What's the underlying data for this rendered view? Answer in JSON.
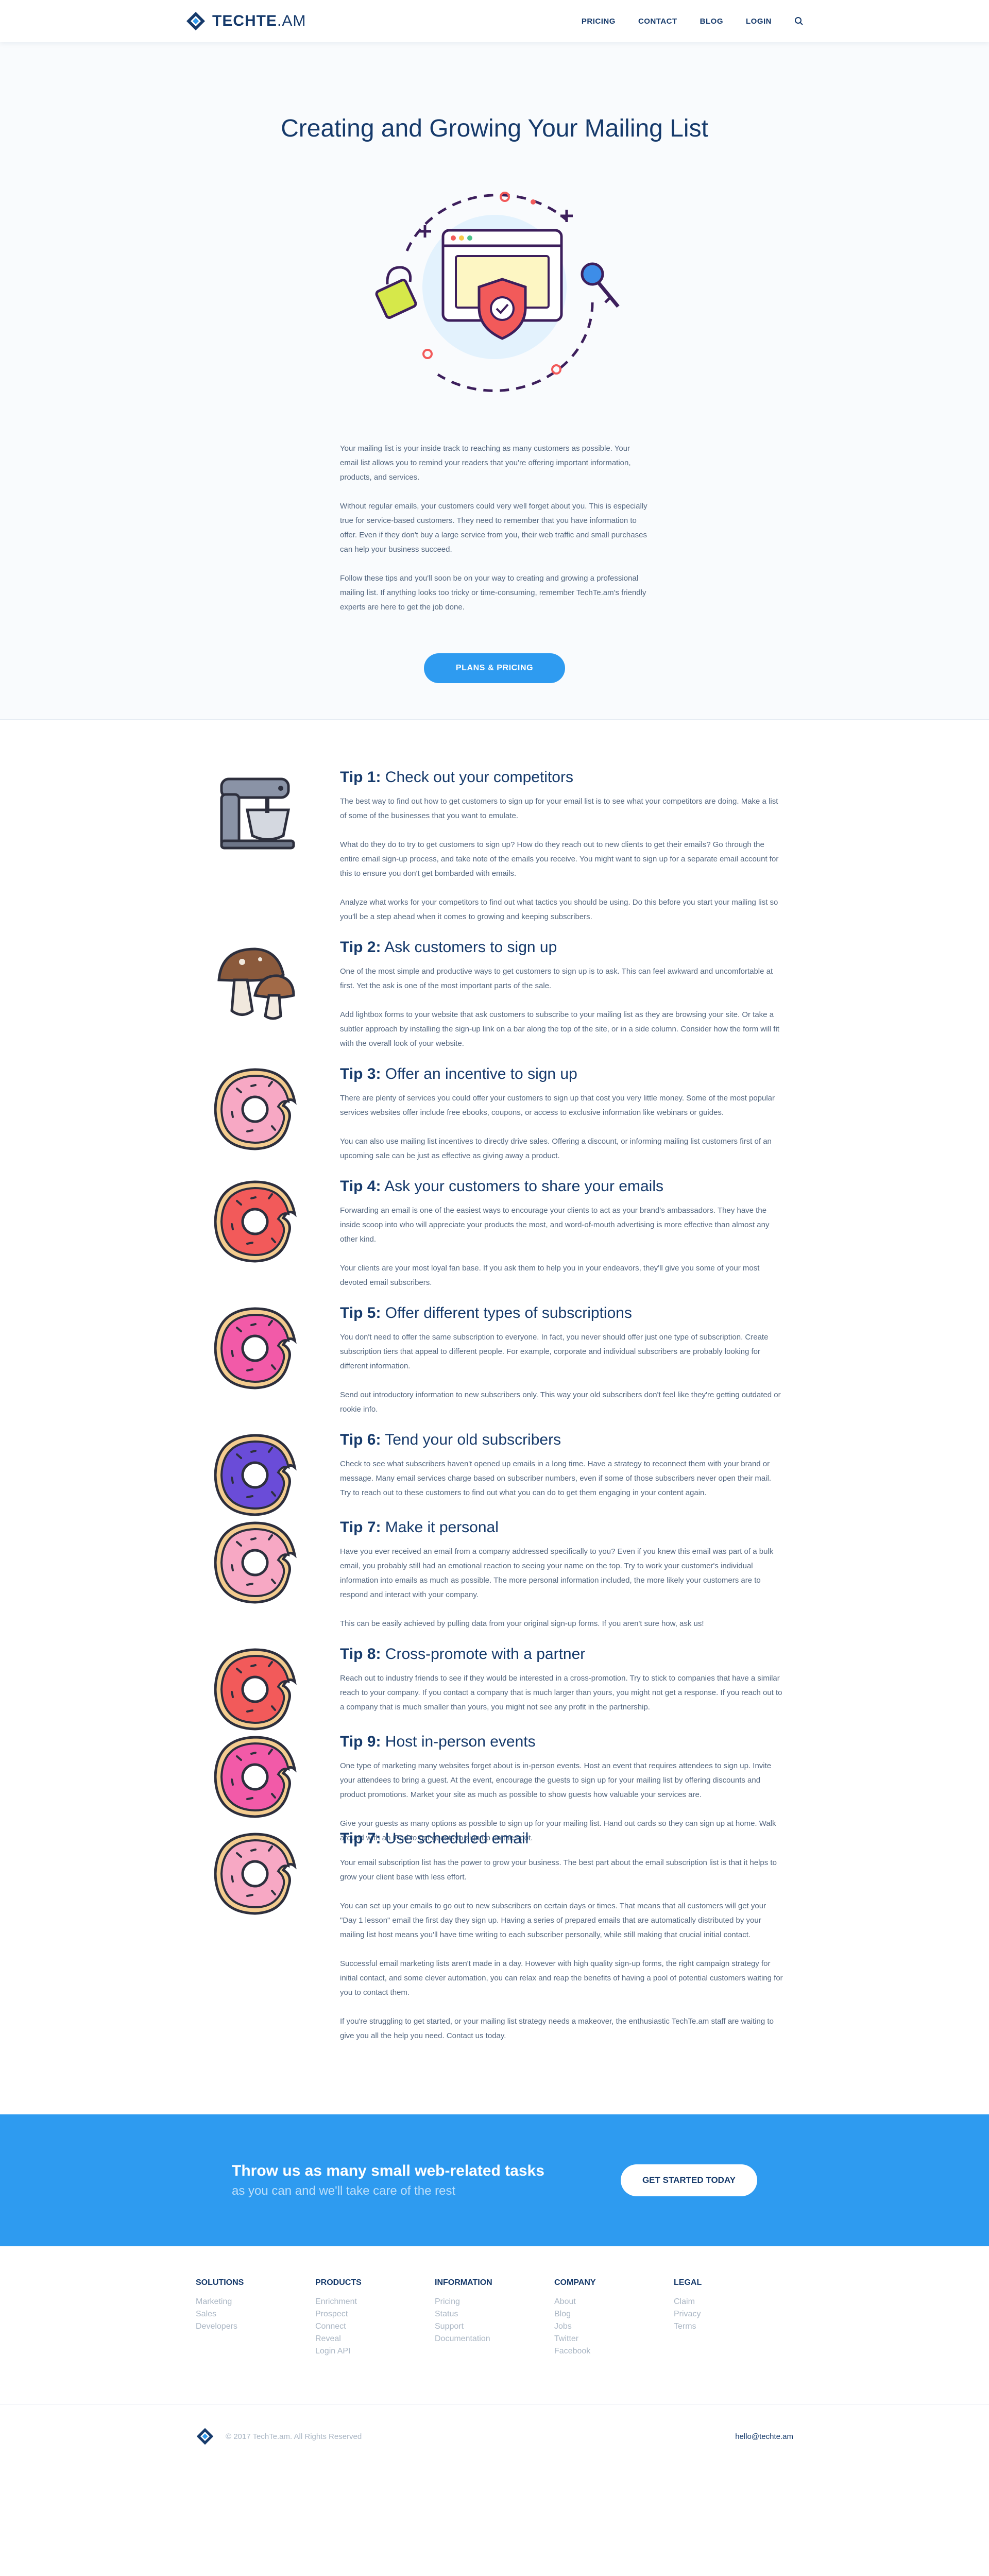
{
  "header": {
    "logo_bold": "TECHTE",
    "logo_rest": ".AM",
    "nav": [
      "PRICING",
      "CONTACT",
      "BLOG",
      "LOGIN"
    ]
  },
  "hero": {
    "title": "Creating and Growing Your Mailing List",
    "paragraphs": [
      "Your mailing list is your inside track to reaching as many customers as possible. Your email list allows you to remind your readers that you're offering important information, products, and services.",
      "Without regular emails, your customers could very well forget about you. This is especially true for service-based customers. They need to remember that you have information to offer. Even if they don't buy a large service from you, their web traffic and small purchases can help your business succeed.",
      "Follow these tips and you'll soon be on your way to creating and growing a professional mailing list. If anything looks too tricky or time-consuming, remember TechTe.am's friendly experts are here to get the job done."
    ],
    "cta": "PLANS & PRICING"
  },
  "tips": [
    {
      "num": "Tip 1:",
      "title": "Check out your competitors",
      "paragraphs": [
        "The best way to find out how to get customers to sign up for your email list is to see what your competitors are doing. Make a list of some of the businesses that you want to emulate.",
        "What do they do to try to get customers to sign up? How do they reach out to new clients to get their emails? Go through the entire email sign-up process, and take note of the emails you receive. You might want to sign up for a separate email account for this to ensure you don't get bombarded with emails.",
        "Analyze what works for your competitors to find out what tactics you should be using. Do this before you start your mailing list so you'll be a step ahead when it comes to growing and keeping subscribers."
      ]
    },
    {
      "num": "Tip 2:",
      "title": "Ask customers to sign up",
      "paragraphs": [
        "One of the most simple and productive ways to get customers to sign up is to ask. This can feel awkward and uncomfortable at first. Yet the ask is one of the most important parts of the sale.",
        "Add lightbox forms to your website that ask customers to subscribe to your mailing list as they are browsing your site. Or take a subtler approach by installing the sign-up link on a bar along the top of the site, or in a side column. Consider how the form will fit with the overall look of your website."
      ]
    },
    {
      "num": "Tip 3:",
      "title": "Offer an incentive to sign up",
      "paragraphs": [
        "There are plenty of services you could offer your customers to sign up that cost you very little money. Some of the most popular services websites offer include free ebooks, coupons, or access to exclusive information like webinars or guides.",
        "You can also use mailing list incentives to directly drive sales. Offering a discount, or informing mailing list customers first of an upcoming sale can be just as effective as giving away a product."
      ]
    },
    {
      "num": "Tip 4:",
      "title": "Ask your customers to share your emails",
      "paragraphs": [
        "Forwarding an email is one of the easiest ways to encourage your clients to act as your brand's ambassadors. They have the inside scoop into who will appreciate your products the most, and word-of-mouth advertising is more effective than almost any other kind.",
        "Your clients are your most loyal fan base. If you ask them to help you in your endeavors, they'll give you some of your most devoted email subscribers."
      ]
    },
    {
      "num": "Tip 5:",
      "title": "Offer different types of subscriptions",
      "paragraphs": [
        "You don't need to offer the same subscription to everyone. In fact, you never should offer just one type of subscription. Create subscription tiers that appeal to different people. For example, corporate and individual subscribers are probably looking for different information.",
        "Send out introductory information to new subscribers only. This way your old subscribers don't feel like they're getting outdated or rookie info."
      ]
    },
    {
      "num": "Tip 6:",
      "title": "Tend your old subscribers",
      "paragraphs": [
        "Check to see what subscribers haven't opened up emails in a long time. Have a strategy to reconnect them with your brand or message. Many email services charge based on subscriber numbers, even if some of those subscribers never open their mail. Try to reach out to these customers to find out what you can do to get them engaging in your content again."
      ]
    },
    {
      "num": "Tip 7:",
      "title": "Make it personal",
      "paragraphs": [
        "Have you ever received an email from a company addressed specifically to you? Even if you knew this email was part of a bulk email, you probably still had an emotional reaction to seeing your name on the top. Try to work your customer's individual information into emails as much as possible. The more personal information included, the more likely your customers are to respond and interact with your company.",
        "This can be easily achieved by pulling data from your original sign-up forms. If you aren't sure how, ask us!"
      ]
    },
    {
      "num": "Tip 8:",
      "title": "Cross-promote with a partner",
      "paragraphs": [
        "Reach out to industry friends to see if they would be interested in a cross-promotion. Try to stick to companies that have a similar reach to your company. If you contact a company that is much larger than yours, you might not get a response. If you reach out to a company that is much smaller than yours, you might not see any profit in the partnership."
      ]
    },
    {
      "num": "Tip 9:",
      "title": "Host in-person events",
      "paragraphs": [
        "One type of marketing many websites forget about is in-person events. Host an event that requires attendees to sign up. Invite your attendees to bring a guest. At the event, encourage the guests to sign up for your mailing list by offering discounts and product promotions. Market your site as much as possible to show guests how valuable your services are.",
        "Give your guests as many options as possible to sign up for your mailing list. Hand out cards so they can sign up at home. Walk around with an iPad to get guests to sign up on the spot."
      ]
    },
    {
      "num": "Tip 7:",
      "title": "Use scheduled email",
      "paragraphs": [
        "Your email subscription list has the power to grow your business. The best part about the email subscription list is that it helps to grow your client base with less effort.",
        "You can set up your emails to go out to new subscribers on certain days or times. That means that all customers will get your \"Day 1 lesson\" email the first day they sign up. Having a series of prepared emails that are automatically distributed by your mailing list host means you'll have time writing to each subscriber personally, while still making that crucial initial contact.",
        "Successful email marketing lists aren't made in a day. However with high quality sign-up forms, the right campaign strategy for initial contact, and some clever automation, you can relax and reap the benefits of having a pool of potential customers waiting for you to contact them.",
        "If you're struggling to get started, or your mailing list strategy needs a makeover, the enthusiastic TechTe.am staff are waiting to give you all the help you need. Contact us today."
      ]
    }
  ],
  "icons": [
    "mixer-icon",
    "mushroom-icon",
    "donut-icon",
    "donut-icon",
    "donut-icon",
    "donut-icon",
    "donut-icon",
    "donut-icon",
    "donut-icon",
    "donut-icon"
  ],
  "donut_colors": [
    "",
    "",
    "#f7a8c4",
    "#f25a5a",
    "#f25aa8",
    "#6a4cd8",
    "#f7a8c4",
    "#f25a5a",
    "#f25aa8",
    "#f7a8c4"
  ],
  "banner": {
    "title": "Throw us as many small web-related tasks",
    "subtitle": "as you can and we'll take care of the rest",
    "button": "GET STARTED TODAY"
  },
  "footer": {
    "columns": [
      {
        "title": "SOLUTIONS",
        "links": [
          "Marketing",
          "Sales",
          "Developers"
        ]
      },
      {
        "title": "PRODUCTS",
        "links": [
          "Enrichment",
          "Prospect",
          "Connect",
          "Reveal",
          "Login API"
        ]
      },
      {
        "title": "INFORMATION",
        "links": [
          "Pricing",
          "Status",
          "Support",
          "Documentation"
        ]
      },
      {
        "title": "COMPANY",
        "links": [
          "About",
          "Blog",
          "Jobs",
          "Twitter",
          "Facebook"
        ]
      },
      {
        "title": "LEGAL",
        "links": [
          "Claim",
          "Privacy",
          "Terms"
        ]
      }
    ],
    "copyright": "© 2017 TechTe.am. All Rights Reserved",
    "email": "hello@techte.am"
  },
  "colors": {
    "navy": "#163a6b",
    "accent": "#2e9bf0",
    "text": "#53667f",
    "muted": "#aab6c4"
  }
}
